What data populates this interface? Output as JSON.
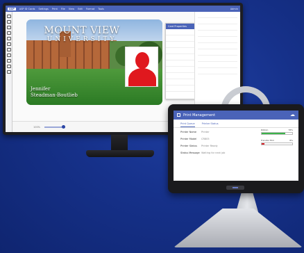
{
  "desktop": {
    "menu": {
      "brand": "ASP",
      "app_name": "ASP ID Cards",
      "items": [
        "Settings",
        "Print",
        "File",
        "View",
        "Edit",
        "Format",
        "Tools"
      ],
      "user": "Admin"
    },
    "card": {
      "title": "MOUNT VIEW",
      "subtitle": "UNIVERSITY",
      "first_name": "Jennifer",
      "last_name": "Steadman-Boutlieb"
    },
    "properties_panel": {
      "header": "Card Properties"
    },
    "status": {
      "zoom_label": "100%"
    }
  },
  "tablet": {
    "title": "Print Management",
    "tabs": [
      "Print Queue",
      "Printer Status"
    ],
    "info": [
      {
        "key": "Printer Name",
        "value": "Printer"
      },
      {
        "key": "Printer Model",
        "value": "CR805"
      },
      {
        "key": "Printer Status",
        "value": "Printer Ready"
      },
      {
        "key": "Status Message",
        "value": "Waiting for next job"
      }
    ],
    "ribbons": [
      {
        "label": "Ribbon",
        "pct_label": "78%",
        "level": 0.78,
        "color": "#3bb34a"
      },
      {
        "label": "Transfer Film",
        "pct_label": "8%",
        "level": 0.08,
        "color": "#d9262b"
      }
    ]
  }
}
